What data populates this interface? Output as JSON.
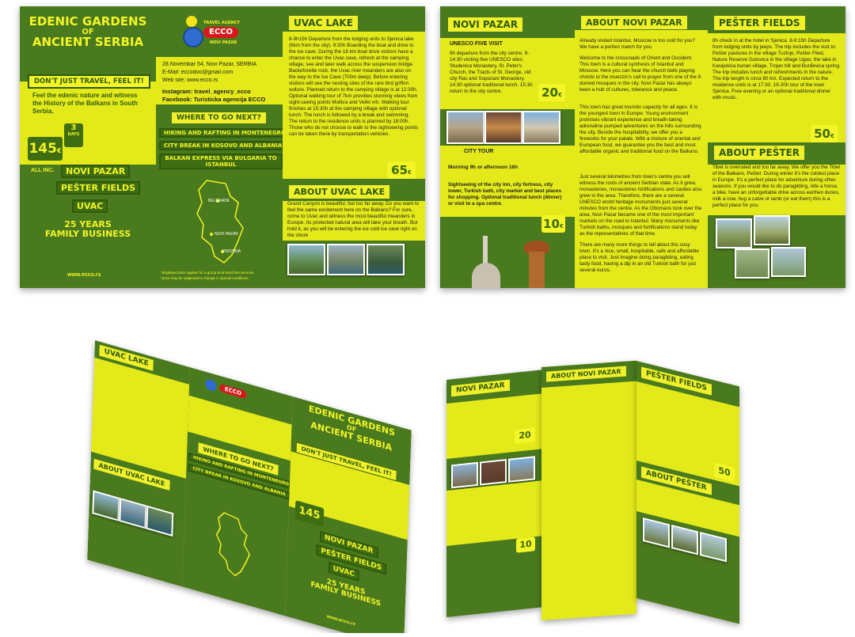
{
  "brand": {
    "agency_label": "TRAVEL AGENCY",
    "name": "ECCO",
    "city": "NOVI PAZAR",
    "website": "www.ecco.rs"
  },
  "front": {
    "title_lines": [
      "EDENIC GARDENS",
      "OF",
      "ANCIENT SERBIA"
    ],
    "slogan": "DON'T JUST TRAVEL, FEEL IT!",
    "intro": "Feel the edenic nature and witness the History of the Balkans in South Serbia.",
    "duration_value": "3",
    "duration_unit": "DAYS",
    "price": "145",
    "price_unit": "€",
    "price_note": "ALL INC.",
    "destinations": [
      "NOVI PAZAR",
      "PEŠTER FIELDS",
      "UVAC"
    ],
    "tagline_lines": [
      "25 YEARS",
      "FAMILY BUSINESS"
    ]
  },
  "contact": {
    "address": "28.Novembar 54, Novi Pazar, SERBIA",
    "email": "E-Mail: eccodoo@gmail.com",
    "web": "Web site: www.ecco.rs",
    "instagram": "Instagram: travel_agency_ecco",
    "facebook": "Facebook: Turisticka agencija ECCO"
  },
  "where_next": {
    "title": "WHERE TO GO NEXT?",
    "items": [
      "HIKING AND RAFTING IN MONTENEGRO",
      "CITY BREAK IN KOSOVO AND ALBANIA",
      "BALKAN EXPRESS VIA BULGARIA TO ISTANBUL"
    ]
  },
  "map_labels": [
    "BELGRADE",
    "NOVI PAZAR",
    "PRISTINA"
  ],
  "disclaimer": [
    "*displayed price applies for a group at at least four persons",
    "*price may be subjected to change in special conditions"
  ],
  "uvac": {
    "title": "UVAC LAKE",
    "text": "8-9h15h Departure from the lodging units to Sjenica lake (6km from the city). 9:30h Boarding the boat and drive to the ice cave. During the 18 km boat drive visitors have a chance to enter the Uvac cave, refresh at the camping village, see and later walk across the suspension bridge. Backeforette rock, the Uvac river meanders are also on the way to the Ice Cave (700m deep). Before entering visitors will see the nesting sites of the rare bird griffon vulture. Planned return to the camping village is at 12:30h. Optional walking tour of 7km provides stunning views from sight-seeing points Molitva and Veliki vrh. Walking tour finishes at 15:30h at the camping village with optional lunch. The lunch is followed by a break and swimming. The return to the residence units is planned by 18:00h. Those who do not choose to walk to the sightseeing points can be taken there by transportation vehicles.",
    "price": "65",
    "about_title": "ABOUT UVAC LAKE",
    "about_text": "Grand Canyon is beautiful, but too far away. Do you want to feel the same excitement here on the Balkans? For sure, come to Uvac and witness the most beautiful meanders in Europe. Its protected natural area will take your breath. But hold it, as you will be entering the ice cold ice cave right on the shore"
  },
  "novi_pazar": {
    "title": "NOVI PAZAR",
    "subtitle": "UNESCO FIVE VISIT",
    "text": "9h departure from the city centre. 9-14:30 visiting five UNESCO sites: Studenica Monastery, St. Peter's Church, the Tracts of St. George, old city Ras and Sopoćani Monastery. 14:30 optional traditional lunch. 15:30 return to the city centre.",
    "price": "20",
    "city_tour_title": "CITY TOUR",
    "city_tour_time": "Morning 9h or afternoon 16h",
    "city_tour_text": "Sightseeing of the city inn, city fortress, city tower, Turkish bath, city market and best places for shopping. Optional traditional lunch (dinner) or visit to a spa centre.",
    "city_tour_price": "10"
  },
  "about_np": {
    "title": "ABOUT NOVI PAZAR",
    "p1": "Already visited Istanbul, Moscow is too cold for you? We have a perfect match for you.",
    "p2": "Welcome to the crossroads of Orient and Occident. This town is a cultural synthesis of Istanbul and Moscow. Here you can hear the church bells playing chords to the muezzin's call to prayer from one of the 8 domed mosques in the city. Novi Pazar has always been a hub of cultures, tolerance and peace.",
    "p3": "This town has great touristic capacity for all ages. It is the youngest town in Europe. Young environment promises vibrant experience and breath-taking adrenaline pumped adventures on the hills surrounding the city. Beside the hospitability, we offer you a fireworks for your palate. With a mixture of oriental and European food, we guarantee you the best and most affordable organic and traditional food on the Balkans.",
    "p4": "Just several kilometres from town's centre you will witness the roots of ancient Serbian state. As it grew, monasteries, monasteries fortifications and castles also grew in the area. Therefore, there are a several UNESCO world heritage monuments just several minutes from the centre. As the Ottomans took over the area, Novi Pazar became one of the most important markets on the road to Istanbul. Many monuments like Turkish baths, mosques and fortifications stand today as the representatives of that time.",
    "p5": "There are many more things to tell about this cosy town. It's a nice, small, hospitable, safe and affordable place to visit. Just imagine doing paragliding, eating tasty food, having a dip in an old Turkish bath for just several euros."
  },
  "pester": {
    "title": "PEŠTER FIELDS",
    "text": "8h check in at the hotel in Sjenica. 8-9:15h Departure from lodging units by jeeps. The trip includes the visit to: Pešter pastures in the village Tuzinje, Pešter Filed, Nature Reserve Gutovica in the village Ugao, the lake in Karajukica bunari village, Trojan hill and Đurđevica spring. The trip includes lunch and refreshments in the nature. The trip length is circa 80 km. Expected return to the residence units is at 17:30. 19-20h tour of the town Sjenica. Free evening or an optional traditional dinner with music.",
    "price": "50",
    "about_title": "ABOUT PEŠTER",
    "about_text": "Tibet is overrated and too far away. We offer you the Tibet of the Balkans, Pešter. During winter it's the coldest place in Europe. It's a perfect place for adventure during other seasons. If you would like to do paragliding, ride a horse, a bike, have an unforgettable drive across earthen dunes, milk a cow, hug a calve or lamb (or eat them) this is a perfect place for you."
  },
  "colors": {
    "dark_green": "#4a7a1e",
    "yellow": "#e4ea1a",
    "label_green": "#3f6d12",
    "accent_red": "#d8181b"
  }
}
